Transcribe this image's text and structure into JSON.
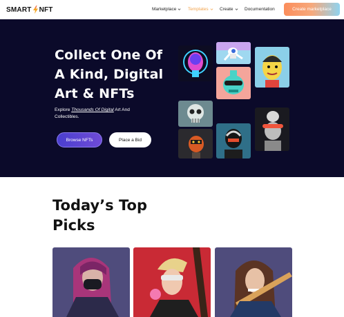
{
  "header": {
    "logo_left": "SMART",
    "logo_right": "NFT",
    "nav": [
      {
        "label": "Marketplace",
        "has_dropdown": true,
        "active": false
      },
      {
        "label": "Templates",
        "has_dropdown": true,
        "active": true
      },
      {
        "label": "Create",
        "has_dropdown": true,
        "active": false
      },
      {
        "label": "Documentation",
        "has_dropdown": false,
        "active": false
      }
    ],
    "cta_label": "Create marketplace"
  },
  "hero": {
    "title": "Collect One Of A Kind, Digital Art & NFTs",
    "subtitle_prefix": "Explore ",
    "subtitle_highlight": "Thousands Of Digital",
    "subtitle_suffix": " Art And Collectibles.",
    "browse_label": "Browse NFTs",
    "bid_label": "Place a Bid"
  },
  "picks": {
    "title": "Today’s Top Picks"
  },
  "colors": {
    "hero_bg": "#0b0a2a",
    "accent_orange": "#f2a34c",
    "cta_gradient_start": "#fb8d5b",
    "cta_gradient_end": "#8fd3ef",
    "browse_purple": "#5a45d3"
  }
}
